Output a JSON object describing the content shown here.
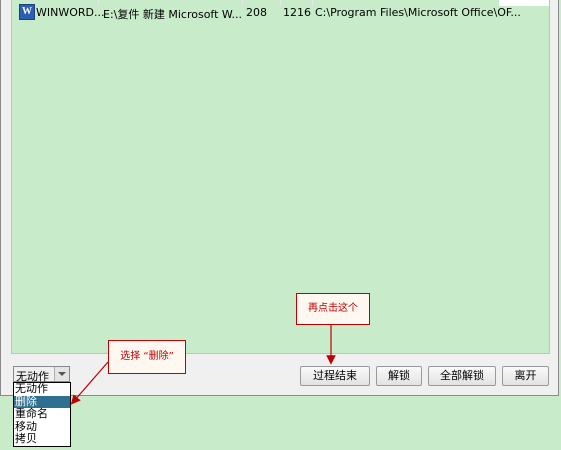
{
  "process_list": {
    "rows": [
      {
        "icon": "word-doc-icon",
        "name": "WINWORD...",
        "file": "E:\\复件 新建 Microsoft W...",
        "pid": "208",
        "memory": "1216",
        "path": "C:\\Program Files\\Microsoft Office\\OF..."
      }
    ]
  },
  "action_select": {
    "value": "无动作",
    "options": [
      "无动作",
      "删除",
      "重命名",
      "移动",
      "拷贝"
    ],
    "highlighted_index": 1
  },
  "buttons": {
    "end_process": "过程结束",
    "unlock": "解锁",
    "unlock_all": "全部解锁",
    "leave": "离开"
  },
  "annotations": {
    "select_delete": "选择 “删除”",
    "click_this": "再点击这个",
    "color": "#c00000"
  },
  "colors": {
    "list_bg": "#c8ecca",
    "window_bg": "#f0f0f0",
    "highlight": "#2f6f8f"
  }
}
